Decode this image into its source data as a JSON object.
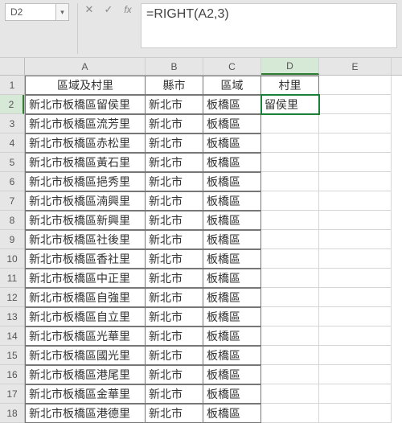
{
  "name_box": {
    "value": "D2"
  },
  "formula_bar": {
    "cancel": "✕",
    "confirm": "✓",
    "fx_label": "fx",
    "formula": "=RIGHT(A2,3)"
  },
  "columns": [
    "A",
    "B",
    "C",
    "D",
    "E"
  ],
  "active_cell": {
    "row": 2,
    "col": "D"
  },
  "headers": {
    "A": "區域及村里",
    "B": "縣市",
    "C": "區域",
    "D": "村里"
  },
  "rows": [
    {
      "n": 2,
      "A": "新北市板橋區留侯里",
      "B": "新北市",
      "C": "板橋區",
      "D": "留侯里"
    },
    {
      "n": 3,
      "A": "新北市板橋區流芳里",
      "B": "新北市",
      "C": "板橋區",
      "D": ""
    },
    {
      "n": 4,
      "A": "新北市板橋區赤松里",
      "B": "新北市",
      "C": "板橋區",
      "D": ""
    },
    {
      "n": 5,
      "A": "新北市板橋區黃石里",
      "B": "新北市",
      "C": "板橋區",
      "D": ""
    },
    {
      "n": 6,
      "A": "新北市板橋區挹秀里",
      "B": "新北市",
      "C": "板橋區",
      "D": ""
    },
    {
      "n": 7,
      "A": "新北市板橋區湳興里",
      "B": "新北市",
      "C": "板橋區",
      "D": ""
    },
    {
      "n": 8,
      "A": "新北市板橋區新興里",
      "B": "新北市",
      "C": "板橋區",
      "D": ""
    },
    {
      "n": 9,
      "A": "新北市板橋區社後里",
      "B": "新北市",
      "C": "板橋區",
      "D": ""
    },
    {
      "n": 10,
      "A": "新北市板橋區香社里",
      "B": "新北市",
      "C": "板橋區",
      "D": ""
    },
    {
      "n": 11,
      "A": "新北市板橋區中正里",
      "B": "新北市",
      "C": "板橋區",
      "D": ""
    },
    {
      "n": 12,
      "A": "新北市板橋區自強里",
      "B": "新北市",
      "C": "板橋區",
      "D": ""
    },
    {
      "n": 13,
      "A": "新北市板橋區自立里",
      "B": "新北市",
      "C": "板橋區",
      "D": ""
    },
    {
      "n": 14,
      "A": "新北市板橋區光華里",
      "B": "新北市",
      "C": "板橋區",
      "D": ""
    },
    {
      "n": 15,
      "A": "新北市板橋區國光里",
      "B": "新北市",
      "C": "板橋區",
      "D": ""
    },
    {
      "n": 16,
      "A": "新北市板橋區港尾里",
      "B": "新北市",
      "C": "板橋區",
      "D": ""
    },
    {
      "n": 17,
      "A": "新北市板橋區金華里",
      "B": "新北市",
      "C": "板橋區",
      "D": ""
    },
    {
      "n": 18,
      "A": "新北市板橋區港德里",
      "B": "新北市",
      "C": "板橋區",
      "D": ""
    }
  ]
}
